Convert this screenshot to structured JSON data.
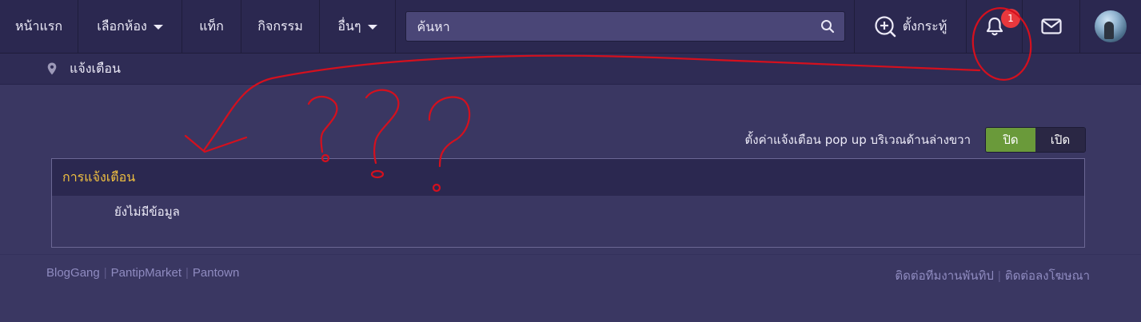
{
  "navbar": {
    "home_label": "หน้าแรก",
    "rooms_label": "เลือกห้อง",
    "tags_label": "แท็ก",
    "activities_label": "กิจกรรม",
    "more_label": "อื่นๆ",
    "search_placeholder": "ค้นหา",
    "new_topic_label": "ตั้งกระทู้",
    "notification_count": "1"
  },
  "breadcrumb": {
    "current": "แจ้งเตือน"
  },
  "popup_setting": {
    "label": "ตั้งค่าแจ้งเตือน pop up บริเวณด้านล่างขวา",
    "off_label": "ปิด",
    "on_label": "เปิด",
    "selected": "off"
  },
  "notifications": {
    "header": "การแจ้งเตือน",
    "empty_text": "ยังไม่มีข้อมูล"
  },
  "footer": {
    "left_links": [
      "BlogGang",
      "PantipMarket",
      "Pantown"
    ],
    "right_links": [
      "ติดต่อทีมงานพันทิป",
      "ติดต่อลงโฆษณา"
    ]
  },
  "colors": {
    "navbar_bg": "#2b2850",
    "page_bg": "#3a3762",
    "header_accent": "#f0c040",
    "toggle_active": "#6a9a3a",
    "badge": "#e8383d",
    "annotation": "#d4101e"
  },
  "icons": [
    "search-icon",
    "add-circle-icon",
    "bell-icon",
    "mail-icon",
    "map-pin-icon",
    "chevron-down-icon"
  ]
}
